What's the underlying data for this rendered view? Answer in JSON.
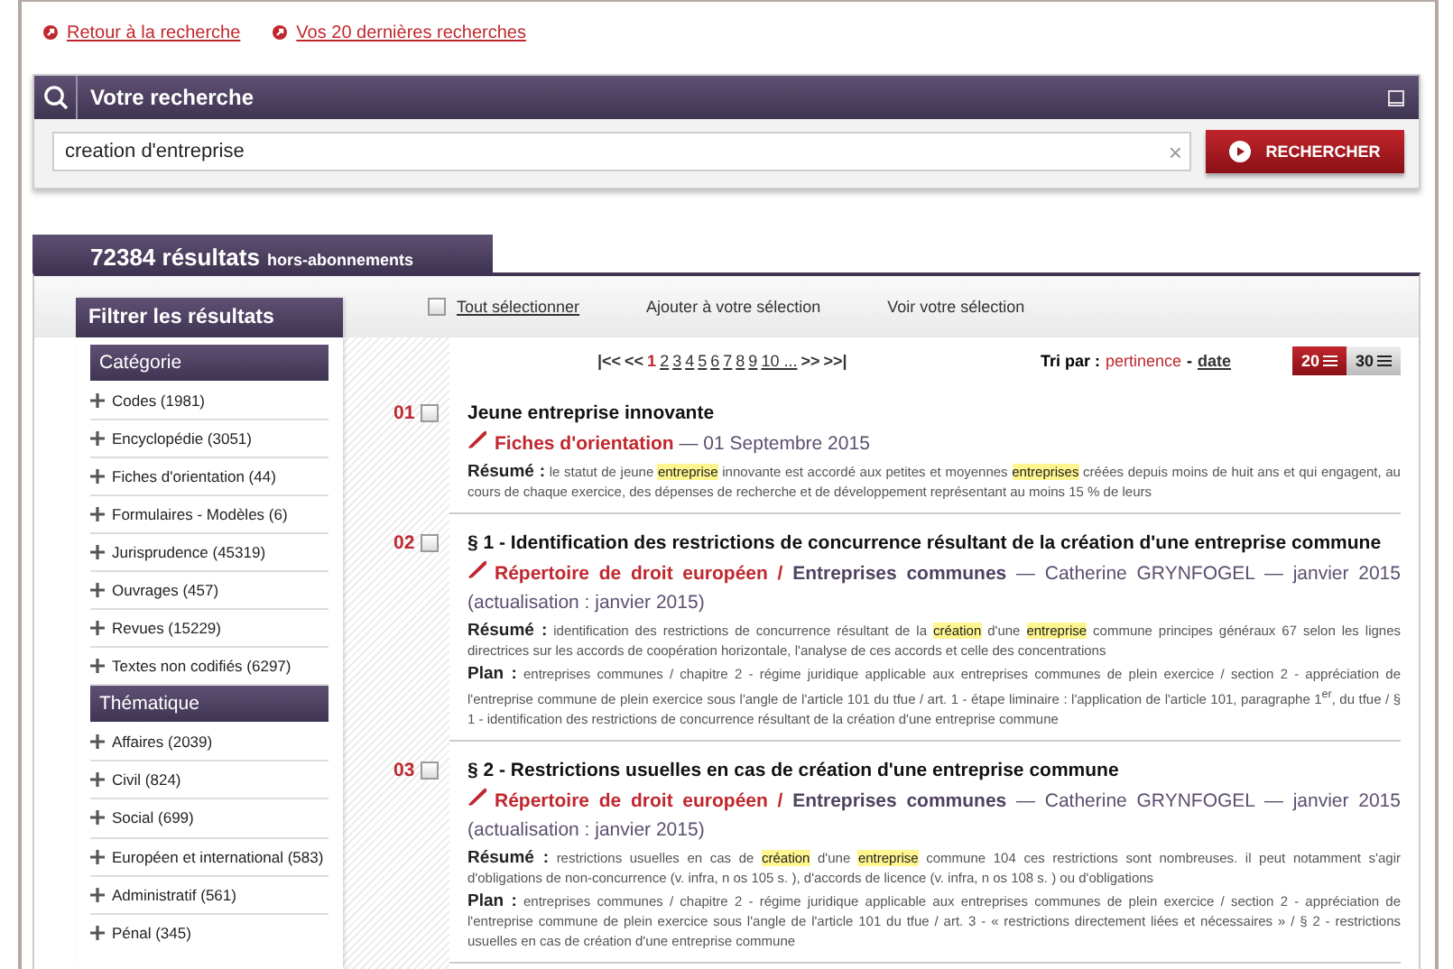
{
  "top_links": [
    {
      "label": "Retour à la recherche"
    },
    {
      "label": "Vos 20 dernières recherches"
    }
  ],
  "search": {
    "title": "Votre recherche",
    "value": "creation d'entreprise",
    "clear": "×",
    "button": "RECHERCHER"
  },
  "results_tab": {
    "count": "72384 résultats",
    "suffix": "hors-abonnements"
  },
  "toolbar": {
    "select_all": {
      "label": "Tout sélectionner",
      "checked": false
    },
    "actions": [
      "Ajouter à votre sélection",
      "Voir votre sélection"
    ]
  },
  "filter": {
    "title": "Filtrer les résultats",
    "sections": [
      {
        "title": "Catégorie",
        "items": [
          "Codes (1981)",
          "Encyclopédie (3051)",
          "Fiches d'orientation (44)",
          "Formulaires - Modèles (6)",
          "Jurisprudence (45319)",
          "Ouvrages (457)",
          "Revues (15229)",
          "Textes non codifiés (6297)"
        ]
      },
      {
        "title": "Thématique",
        "items": [
          "Affaires (2039)",
          "Civil (824)",
          "Social (699)",
          "Européen et international (583)",
          "Administratif (561)",
          "Pénal (345)"
        ]
      }
    ]
  },
  "pagination": {
    "first": "|<<",
    "prev": "<<",
    "pages": [
      {
        "label": "1",
        "selected": true
      },
      {
        "label": "2",
        "selected": false
      },
      {
        "label": "3",
        "selected": false
      },
      {
        "label": "4",
        "selected": false
      },
      {
        "label": "5",
        "selected": false
      },
      {
        "label": "6",
        "selected": false
      },
      {
        "label": "7",
        "selected": false
      },
      {
        "label": "8",
        "selected": false
      },
      {
        "label": "9",
        "selected": false
      },
      {
        "label": "10 ...",
        "selected": false
      }
    ],
    "next": ">>",
    "last": ">>|"
  },
  "sort": {
    "label": "Tri par :",
    "separator": "-",
    "options": [
      {
        "label": "pertinence",
        "selected": true
      },
      {
        "label": "date",
        "selected": false
      }
    ]
  },
  "per_page": [
    {
      "label": "20",
      "selected": true
    },
    {
      "label": "30",
      "selected": false
    }
  ],
  "results": [
    {
      "number": "01",
      "checked": false,
      "title": "Jeune entreprise innovante",
      "collection": "Fiches d'orientation",
      "meta": "— 01 Septembre 2015",
      "summary_label": "Résumé :",
      "summary": [
        {
          "text": "le statut de jeune ",
          "highlight": false
        },
        {
          "text": "entreprise",
          "highlight": true
        },
        {
          "text": " innovante est accordé aux petites et moyennes ",
          "highlight": false
        },
        {
          "text": "entreprises",
          "highlight": true
        },
        {
          "text": " créées depuis moins de huit ans et qui engagent, au cours de chaque exercice, des dépenses de recherche et de développement représentant au moins 15 % de leurs",
          "highlight": false
        }
      ]
    },
    {
      "number": "02",
      "checked": false,
      "title": "§ 1 - Identification des restrictions de concurrence résultant de la création d'une entreprise commune",
      "collection": "Répertoire de droit européen",
      "separator": "/",
      "subcollection": "Entreprises communes",
      "meta": "— Catherine GRYNFOGEL — janvier 2015 (actualisation : janvier 2015)",
      "summary_label": "Résumé :",
      "summary": [
        {
          "text": "identification des restrictions de concurrence résultant de la ",
          "highlight": false
        },
        {
          "text": "création",
          "highlight": true
        },
        {
          "text": " d'une ",
          "highlight": false
        },
        {
          "text": "entreprise",
          "highlight": true
        },
        {
          "text": " commune principes généraux 67 selon les lignes directrices sur les accords de coopération horizontale, l'analyse de ces accords et celle des concentrations",
          "highlight": false
        }
      ],
      "plan_label": "Plan :",
      "plan": "entreprises communes / chapitre 2 - régime juridique applicable aux entreprises communes de plein exercice / section 2 - appréciation de l'entreprise commune de plein exercice sous l'angle de l'article 101 du tfue / art. 1 - étape liminaire : l'application de l'article 101, paragraphe 1$^{er}$, du tfue / § 1 - identification des restrictions de concurrence résultant de la création d'une entreprise commune"
    },
    {
      "number": "03",
      "checked": false,
      "title": "§ 2 - Restrictions usuelles en cas de création d'une entreprise commune",
      "collection": "Répertoire de droit européen",
      "separator": "/",
      "subcollection": "Entreprises communes",
      "meta": "— Catherine GRYNFOGEL — janvier 2015 (actualisation : janvier 2015)",
      "summary_label": "Résumé :",
      "summary": [
        {
          "text": "restrictions usuelles en cas de ",
          "highlight": false
        },
        {
          "text": "création",
          "highlight": true
        },
        {
          "text": " d'une ",
          "highlight": false
        },
        {
          "text": "entreprise",
          "highlight": true
        },
        {
          "text": " commune 104 ces restrictions sont nombreuses. il peut notamment s'agir d'obligations de non-concurrence (v. infra, n os 105 s. ), d'accords de licence (v. infra, n os 108 s. ) ou d'obligations",
          "highlight": false
        }
      ],
      "plan_label": "Plan :",
      "plan": "entreprises communes / chapitre 2 - régime juridique applicable aux entreprises communes de plein exercice / section 2 - appréciation de l'entreprise commune de plein exercice sous l'angle de l'article 101 du tfue / art. 3 - « restrictions directement liées et nécessaires » / § 2 - restrictions usuelles en cas de création d'une entreprise commune"
    }
  ]
}
